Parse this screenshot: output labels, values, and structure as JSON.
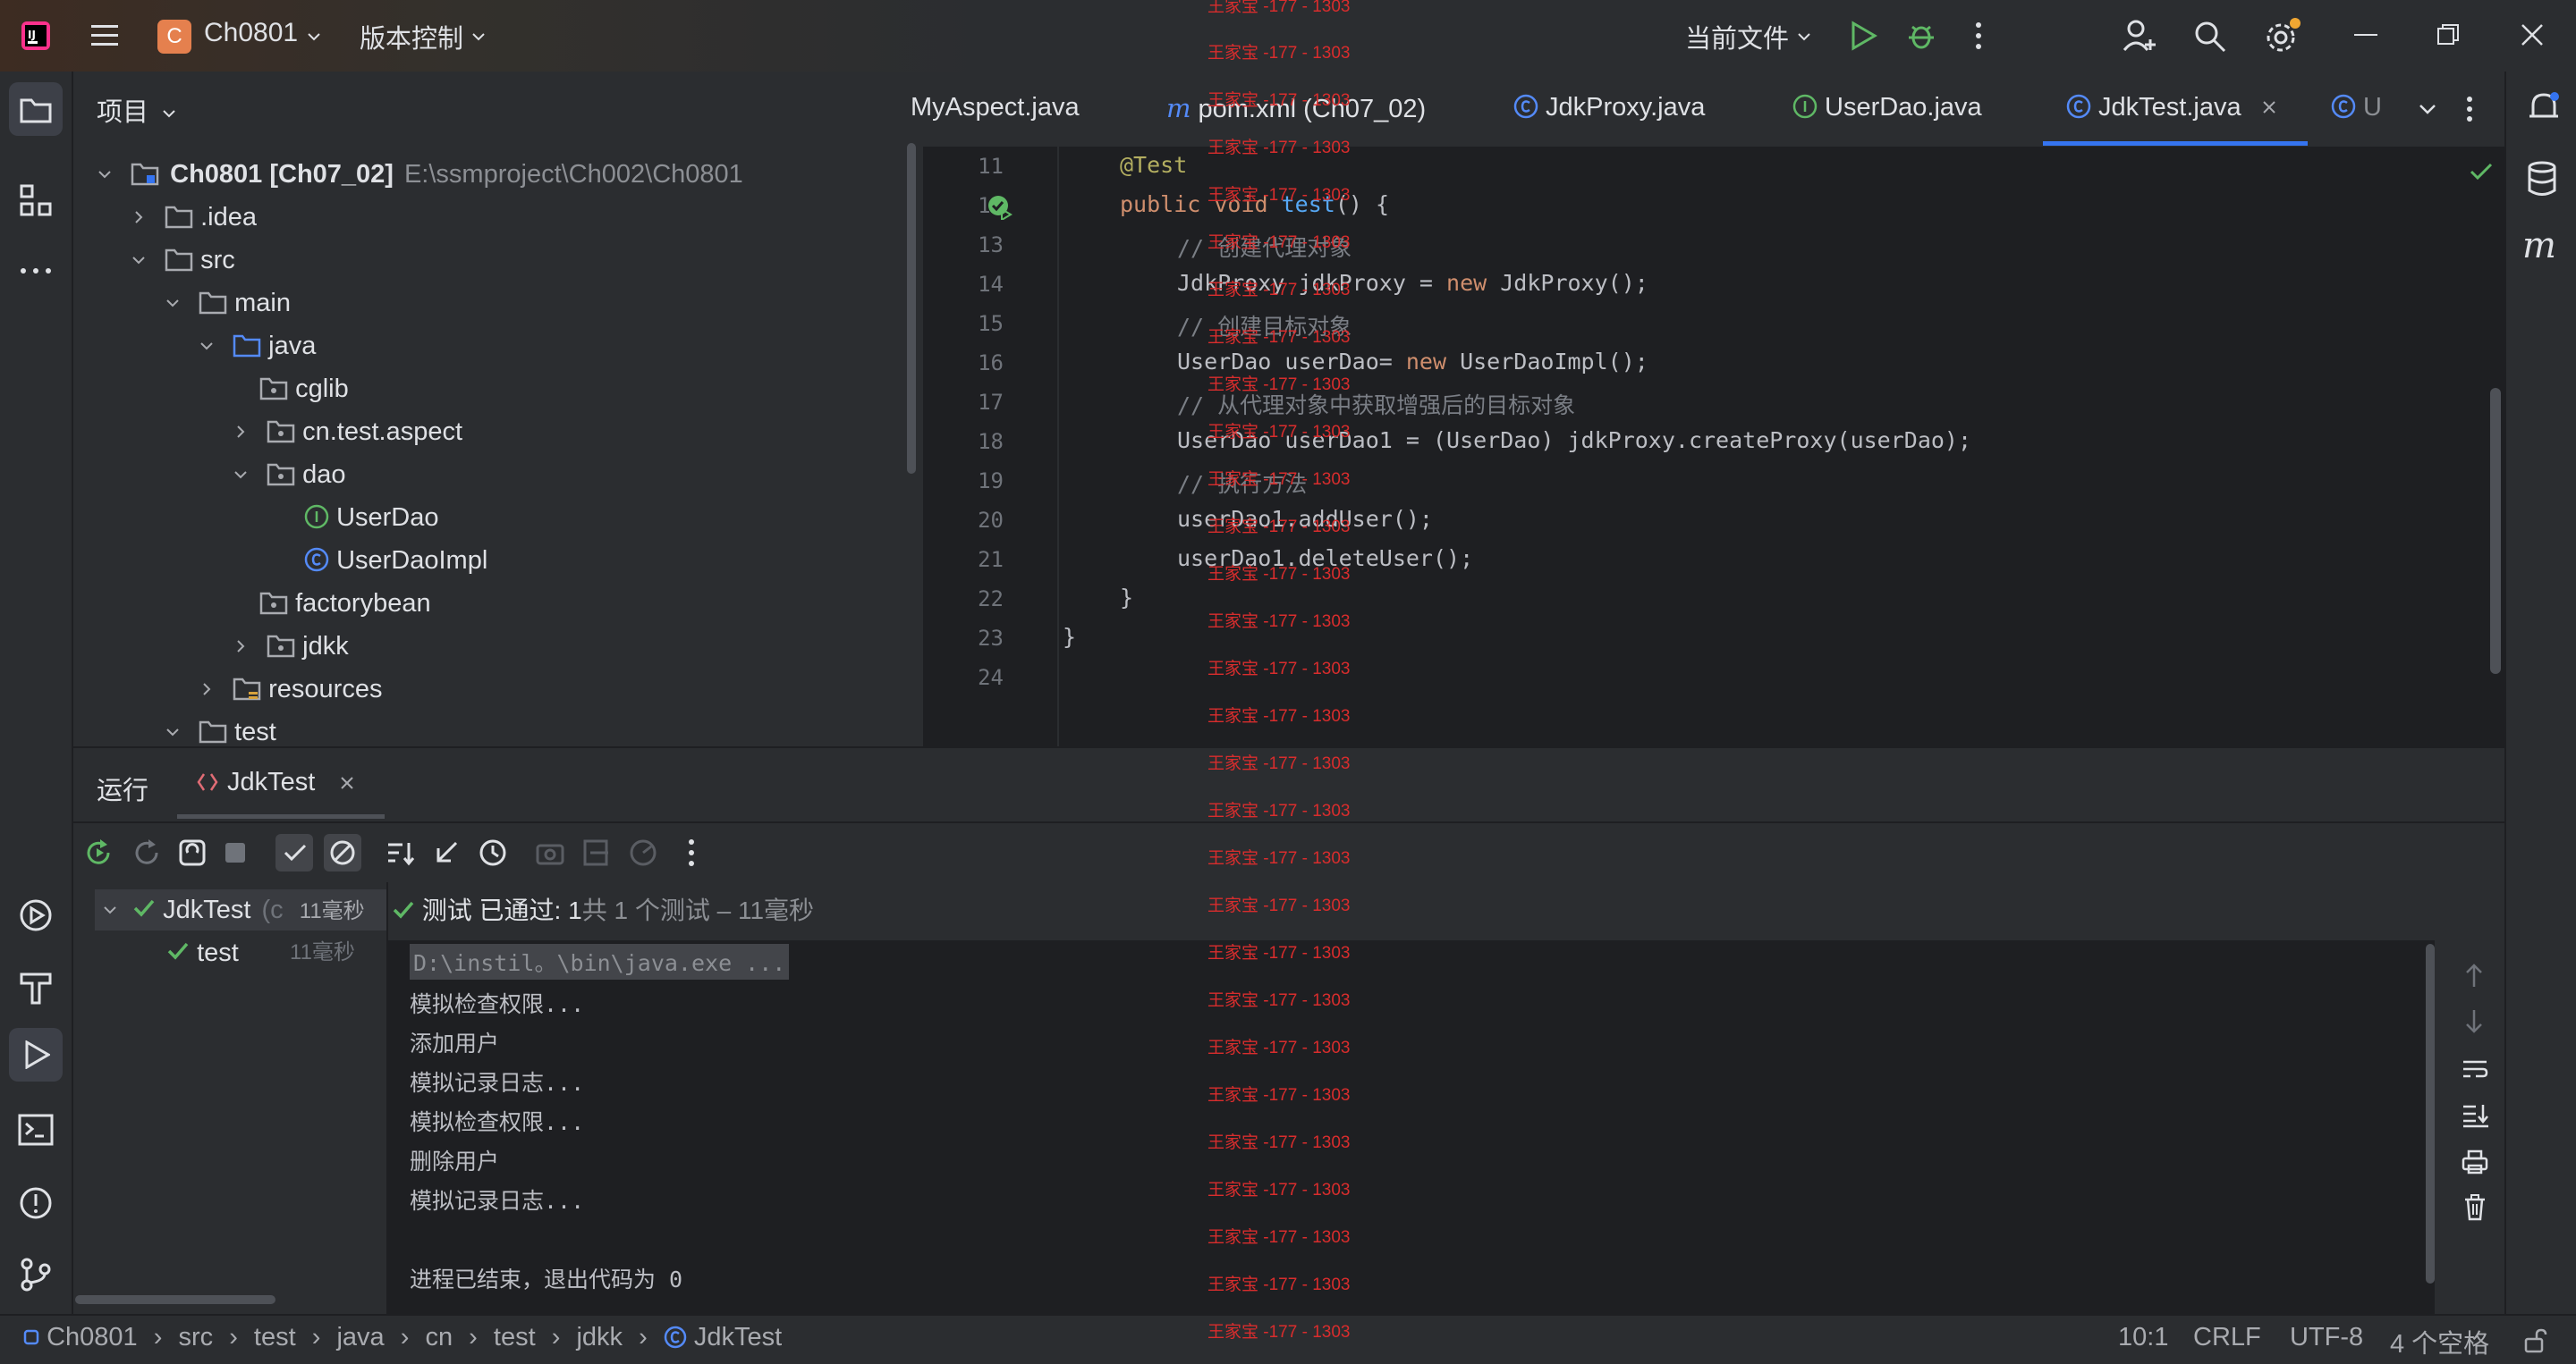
{
  "titlebar": {
    "project_badge": "C",
    "project_name": "Ch0801",
    "vcs_label": "版本控制",
    "run_config": "当前文件"
  },
  "project_panel": {
    "title": "项目",
    "root_name": "Ch0801 [Ch07_02]",
    "root_path": "E:\\ssmproject\\Ch002\\Ch0801",
    "items": [
      {
        "label": "Ch0801 [Ch07_02]",
        "path": "E:\\ssmproject\\Ch002\\Ch0801"
      },
      {
        "label": ".idea"
      },
      {
        "label": "src"
      },
      {
        "label": "main"
      },
      {
        "label": "java"
      },
      {
        "label": "cglib"
      },
      {
        "label": "cn.test.aspect"
      },
      {
        "label": "dao"
      },
      {
        "label": "UserDao"
      },
      {
        "label": "UserDaoImpl"
      },
      {
        "label": "factorybean"
      },
      {
        "label": "jdkk"
      },
      {
        "label": "resources"
      },
      {
        "label": "test"
      }
    ]
  },
  "editor": {
    "tabs": [
      {
        "label": "MyAspect.java",
        "icon": "class-icon"
      },
      {
        "label": "pom.xml (Ch07_02)",
        "icon": "maven-icon"
      },
      {
        "label": "JdkProxy.java",
        "icon": "class-icon"
      },
      {
        "label": "UserDao.java",
        "icon": "interface-icon"
      },
      {
        "label": "JdkTest.java",
        "icon": "class-icon",
        "active": true
      },
      {
        "label": "U",
        "icon": "class-icon"
      }
    ],
    "line_numbers": [
      "11",
      "12",
      "13",
      "14",
      "15",
      "16",
      "17",
      "18",
      "19",
      "20",
      "21",
      "22",
      "23",
      "24"
    ],
    "code": {
      "l11": "@Test",
      "l12_kw": "public void ",
      "l12_fn": "test",
      "l12_rest": "() {",
      "l13": "// 创建代理对象",
      "l14_a": "JdkProxy jdkProxy = ",
      "l14_kw": "new",
      "l14_b": " JdkProxy();",
      "l15": "// 创建目标对象",
      "l16_a": "UserDao userDao= ",
      "l16_kw": "new",
      "l16_b": " UserDaoImpl();",
      "l17": "// 从代理对象中获取增强后的目标对象",
      "l18": "UserDao userDao1 = (UserDao) jdkProxy.createProxy(userDao);",
      "l19": "// 执行方法",
      "l20": "userDao1.addUser();",
      "l21": "userDao1.deleteUser();",
      "l22": "}",
      "l23": "}"
    }
  },
  "run_panel": {
    "title": "运行",
    "tab_label": "JdkTest",
    "tree": {
      "root_label": "JdkTest",
      "root_paren": "(c",
      "root_time": "11毫秒",
      "child_label": "test",
      "child_time": "11毫秒"
    },
    "status_prefix": "测试 已通过: 1",
    "status_suffix": "共 1 个测试 – 11毫秒",
    "console": [
      "D:\\instil。\\bin\\java.exe ...",
      "模拟检查权限...",
      "添加用户",
      "模拟记录日志...",
      "模拟检查权限...",
      "删除用户",
      "模拟记录日志...",
      "",
      "进程已结束，退出代码为 0"
    ]
  },
  "statusbar": {
    "breadcrumbs": [
      "Ch0801",
      "src",
      "test",
      "java",
      "cn",
      "test",
      "jdkk",
      "JdkTest"
    ],
    "position": "10:1",
    "line_sep": "CRLF",
    "encoding": "UTF-8",
    "indent": "4 个空格"
  },
  "watermark": "王家宝 -177 - 1303",
  "colors": {
    "accent": "#3574f0",
    "pass": "#5fb865",
    "watermark": "#d92d2d"
  }
}
